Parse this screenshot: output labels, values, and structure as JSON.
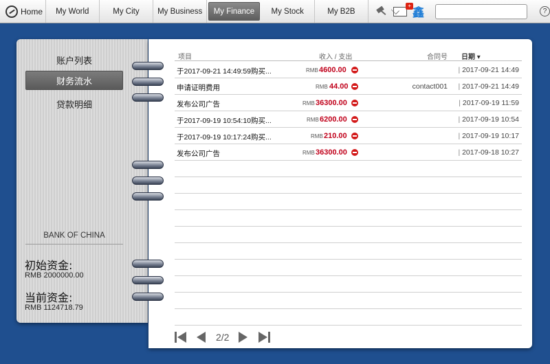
{
  "nav": {
    "home": "Home",
    "tabs": [
      {
        "label": "My World",
        "active": false
      },
      {
        "label": "My City",
        "active": false
      },
      {
        "label": "My Business",
        "active": false
      },
      {
        "label": "My Finance",
        "active": true
      },
      {
        "label": "My Stock",
        "active": false
      },
      {
        "label": "My B2B",
        "active": false
      }
    ],
    "mail_badge": "+",
    "xin_glyph": "鑫",
    "help_glyph": "?"
  },
  "sidebar": {
    "items": [
      {
        "label": "账户列表",
        "active": false
      },
      {
        "label": "财务流水",
        "active": true
      },
      {
        "label": "贷款明细",
        "active": false
      }
    ],
    "bank_name": "BANK OF CHINA",
    "initial_label": "初始资金:",
    "initial_value": "RMB 2000000.00",
    "current_label": "当前资金:",
    "current_value": "RMB 1124718.79"
  },
  "table": {
    "headers": {
      "item": "项目",
      "amount": "收入 / 支出",
      "contract": "合同号",
      "date": "日期 ▾"
    },
    "rows": [
      {
        "item": "于2017-09-21 14:49:59购买...",
        "currency": "RMB",
        "amount": "4600.00",
        "contract": "",
        "date": "2017-09-21 14:49"
      },
      {
        "item": "申请证明费用",
        "currency": "RMB",
        "amount": "44.00",
        "contract": "contact001",
        "date": "2017-09-21 14:49"
      },
      {
        "item": "发布公司广告",
        "currency": "RMB",
        "amount": "36300.00",
        "contract": "",
        "date": "2017-09-19 11:59"
      },
      {
        "item": "于2017-09-19 10:54:10购买...",
        "currency": "RMB",
        "amount": "6200.00",
        "contract": "",
        "date": "2017-09-19 10:54"
      },
      {
        "item": "于2017-09-19 10:17:24购买...",
        "currency": "RMB",
        "amount": "210.00",
        "contract": "",
        "date": "2017-09-19 10:17"
      },
      {
        "item": "发布公司广告",
        "currency": "RMB",
        "amount": "36300.00",
        "contract": "",
        "date": "2017-09-18 10:27"
      }
    ]
  },
  "pager": {
    "text": "2/2"
  }
}
